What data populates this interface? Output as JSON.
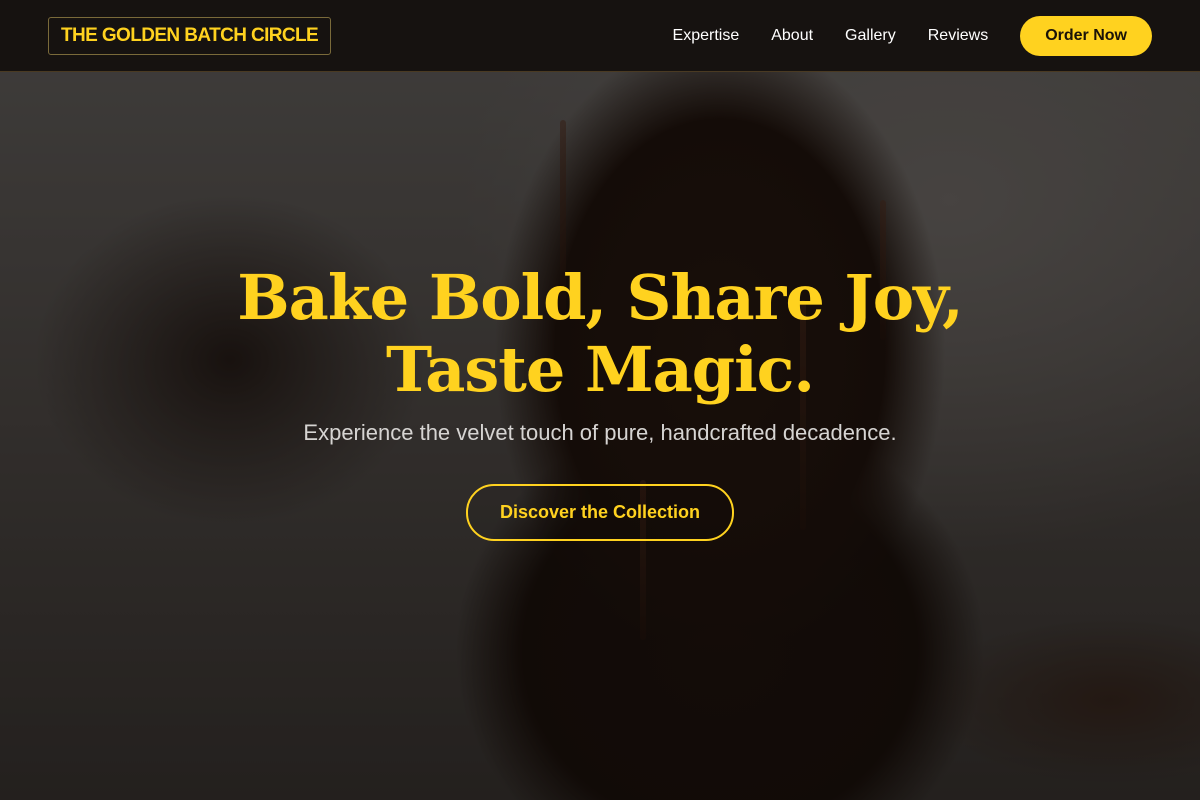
{
  "brand": {
    "name": "THE GOLDEN BATCH CIRCLE"
  },
  "nav": {
    "links": [
      "Expertise",
      "About",
      "Gallery",
      "Reviews"
    ],
    "cta_label": "Order Now"
  },
  "hero": {
    "headline_line1": "Bake Bold, Share Joy,",
    "headline_line2": "Taste Magic.",
    "subtitle": "Experience the velvet touch of pure, handcrafted decadence.",
    "cta_label": "Discover the Collection",
    "background_image": "chocolate-brownie-photo"
  },
  "colors": {
    "accent": "#FFD21F",
    "header_bg": "#161210",
    "text_light": "#ffffff"
  }
}
